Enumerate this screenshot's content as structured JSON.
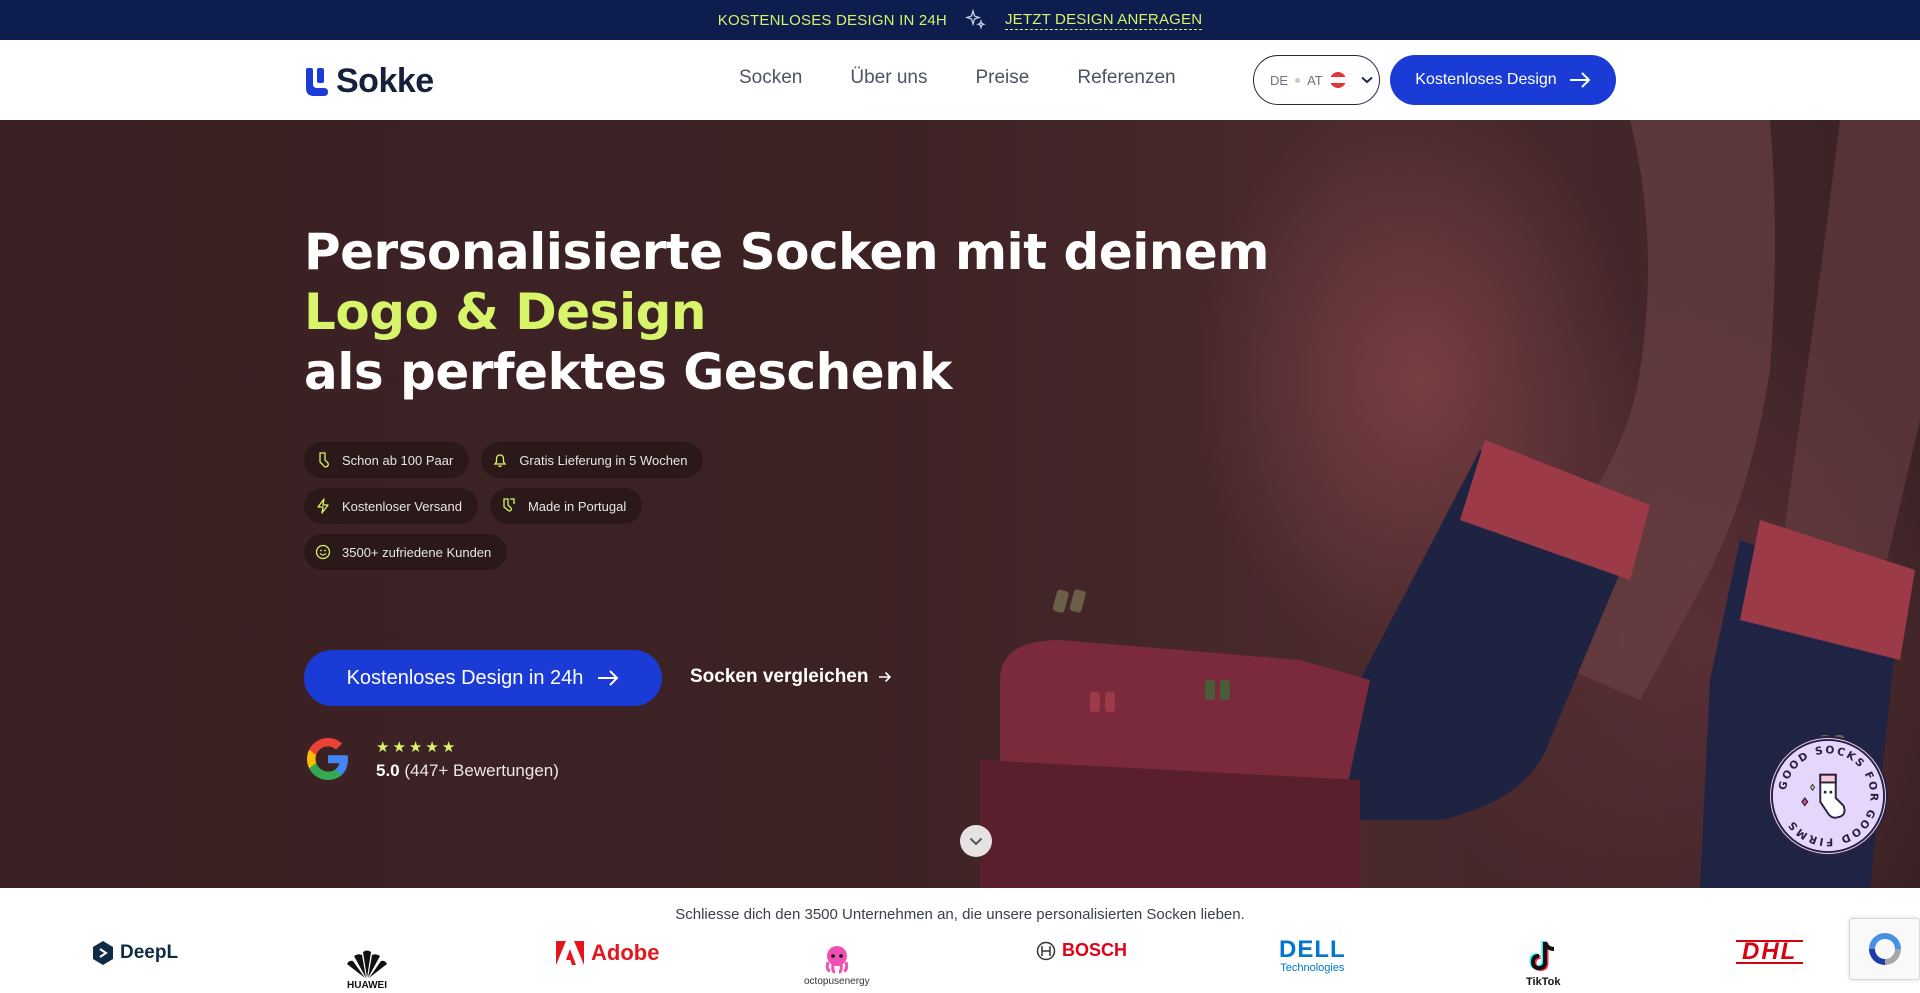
{
  "topbar": {
    "text": "KOSTENLOSES DESIGN IN 24H",
    "link": "JETZT DESIGN ANFRAGEN"
  },
  "header": {
    "logo_text": "Sokke",
    "nav": [
      "Socken",
      "Über uns",
      "Preise",
      "Referenzen"
    ],
    "lang_de": "DE",
    "lang_at": "AT",
    "cta": "Kostenloses Design"
  },
  "hero": {
    "title_line1": "Personalisierte Socken mit deinem",
    "title_line2": "Logo & Design",
    "title_line3": "als perfektes Geschenk",
    "badges": [
      {
        "label": "Schon ab 100 Paar",
        "icon": "sock-icon"
      },
      {
        "label": "Gratis Lieferung in 5 Wochen",
        "icon": "bell-icon"
      },
      {
        "label": "Kostenloser Versand",
        "icon": "lightning-icon"
      },
      {
        "label": "Made in Portugal",
        "icon": "socks-pair-icon"
      },
      {
        "label": "3500+ zufriedene Kunden",
        "icon": "smiley-icon"
      }
    ],
    "cta_primary": "Kostenloses Design in 24h",
    "cta_secondary": "Socken vergleichen",
    "rating_score": "5.0",
    "rating_count": "(447+ Bewertungen)",
    "stars": 5
  },
  "band": {
    "text": "Schliesse dich den 3500 Unternehmen an, die unsere personalisierten Socken lieben.",
    "brands": [
      "DeepL",
      "HUAWEI",
      "Adobe",
      "octopusenergy",
      "BOSCH",
      "DELL",
      "Technologies",
      "TikTok",
      "DHL"
    ]
  },
  "seal": {
    "text": "GOOD SOCKS FOR GOOD FIRMS"
  },
  "colors": {
    "navy": "#0d1d4d",
    "accent_blue": "#1a3bd6",
    "lime": "#d8f46a"
  }
}
